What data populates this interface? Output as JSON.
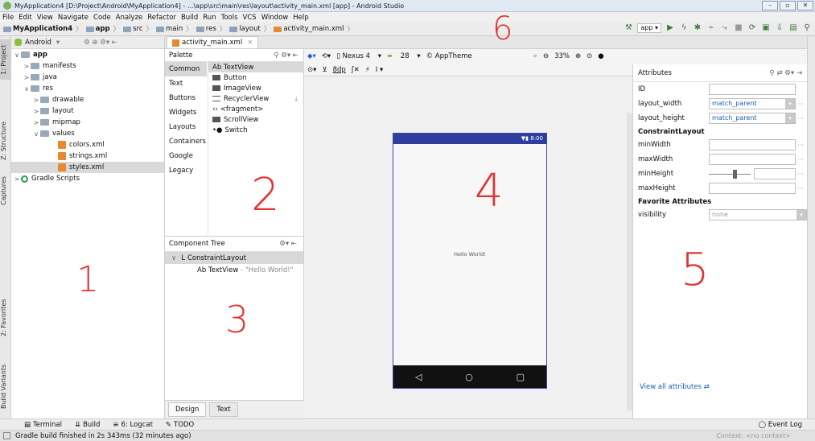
{
  "window": {
    "title": "MyApplication4 [D:\\Project\\Android\\MyApplication4] - ...\\app\\src\\main\\res\\layout\\activity_main.xml [app] - Android Studio"
  },
  "menu": [
    "File",
    "Edit",
    "View",
    "Navigate",
    "Code",
    "Analyze",
    "Refactor",
    "Build",
    "Run",
    "Tools",
    "VCS",
    "Window",
    "Help"
  ],
  "breadcrumbs": [
    "MyApplication4",
    "app",
    "src",
    "main",
    "res",
    "layout",
    "activity_main.xml"
  ],
  "toolbar": {
    "run_config": "app"
  },
  "left_tabs": [
    "1: Project",
    "Z: Structure",
    "Captures",
    "2: Favorites",
    "Build Variants"
  ],
  "project": {
    "view": "Android",
    "tree": [
      {
        "label": "app",
        "arrow": "∨"
      },
      {
        "label": "manifests",
        "arrow": ">"
      },
      {
        "label": "java",
        "arrow": ">"
      },
      {
        "label": "res",
        "arrow": "∨"
      },
      {
        "label": "drawable",
        "arrow": ">"
      },
      {
        "label": "layout",
        "arrow": ">"
      },
      {
        "label": "mipmap",
        "arrow": ">"
      },
      {
        "label": "values",
        "arrow": "∨"
      },
      {
        "label": "colors.xml"
      },
      {
        "label": "strings.xml"
      },
      {
        "label": "styles.xml"
      },
      {
        "label": "Gradle Scripts",
        "arrow": ">"
      }
    ]
  },
  "editor": {
    "tab": "activity_main.xml"
  },
  "palette": {
    "title": "Palette",
    "categories": [
      "Common",
      "Text",
      "Buttons",
      "Widgets",
      "Layouts",
      "Containers",
      "Google",
      "Legacy"
    ],
    "items": [
      "Ab TextView",
      "Button",
      "ImageView",
      "RecyclerView",
      "<fragment>",
      "ScrollView",
      "Switch"
    ]
  },
  "component_tree": {
    "title": "Component Tree",
    "root": "ConstraintLayout",
    "child": "Ab TextView",
    "child_value": "- \"Hello World!\""
  },
  "design_toolbar": {
    "device": "Nexus 4",
    "api": "28",
    "theme": "AppTheme",
    "zoom": "33%",
    "margin": "8dp"
  },
  "preview": {
    "time": "8:00",
    "hello": "Hello World!"
  },
  "bottom_tabs": {
    "design": "Design",
    "text": "Text"
  },
  "attributes": {
    "title": "Attributes",
    "id_label": "ID",
    "layout_width_label": "layout_width",
    "layout_width": "match_parent",
    "layout_height_label": "layout_height",
    "layout_height": "match_parent",
    "constraint_section": "ConstraintLayout",
    "min_width": "minWidth",
    "max_width": "maxWidth",
    "min_height": "minHeight",
    "max_height": "maxHeight",
    "favorites_section": "Favorite Attributes",
    "visibility_label": "visibility",
    "visibility": "none",
    "view_all": "View all attributes"
  },
  "bottom_tools": [
    "Terminal",
    "Build",
    "6: Logcat",
    "TODO"
  ],
  "event_log": "Event Log",
  "status": {
    "message": "Gradle build finished in 2s 343ms (32 minutes ago)",
    "context": "Context: <no context>"
  },
  "annotations": [
    "1",
    "2",
    "3",
    "4",
    "5",
    "6"
  ],
  "colors": {
    "accent": "#2f3d9f",
    "annotation": "#e23333",
    "link": "#1a5fb4"
  }
}
